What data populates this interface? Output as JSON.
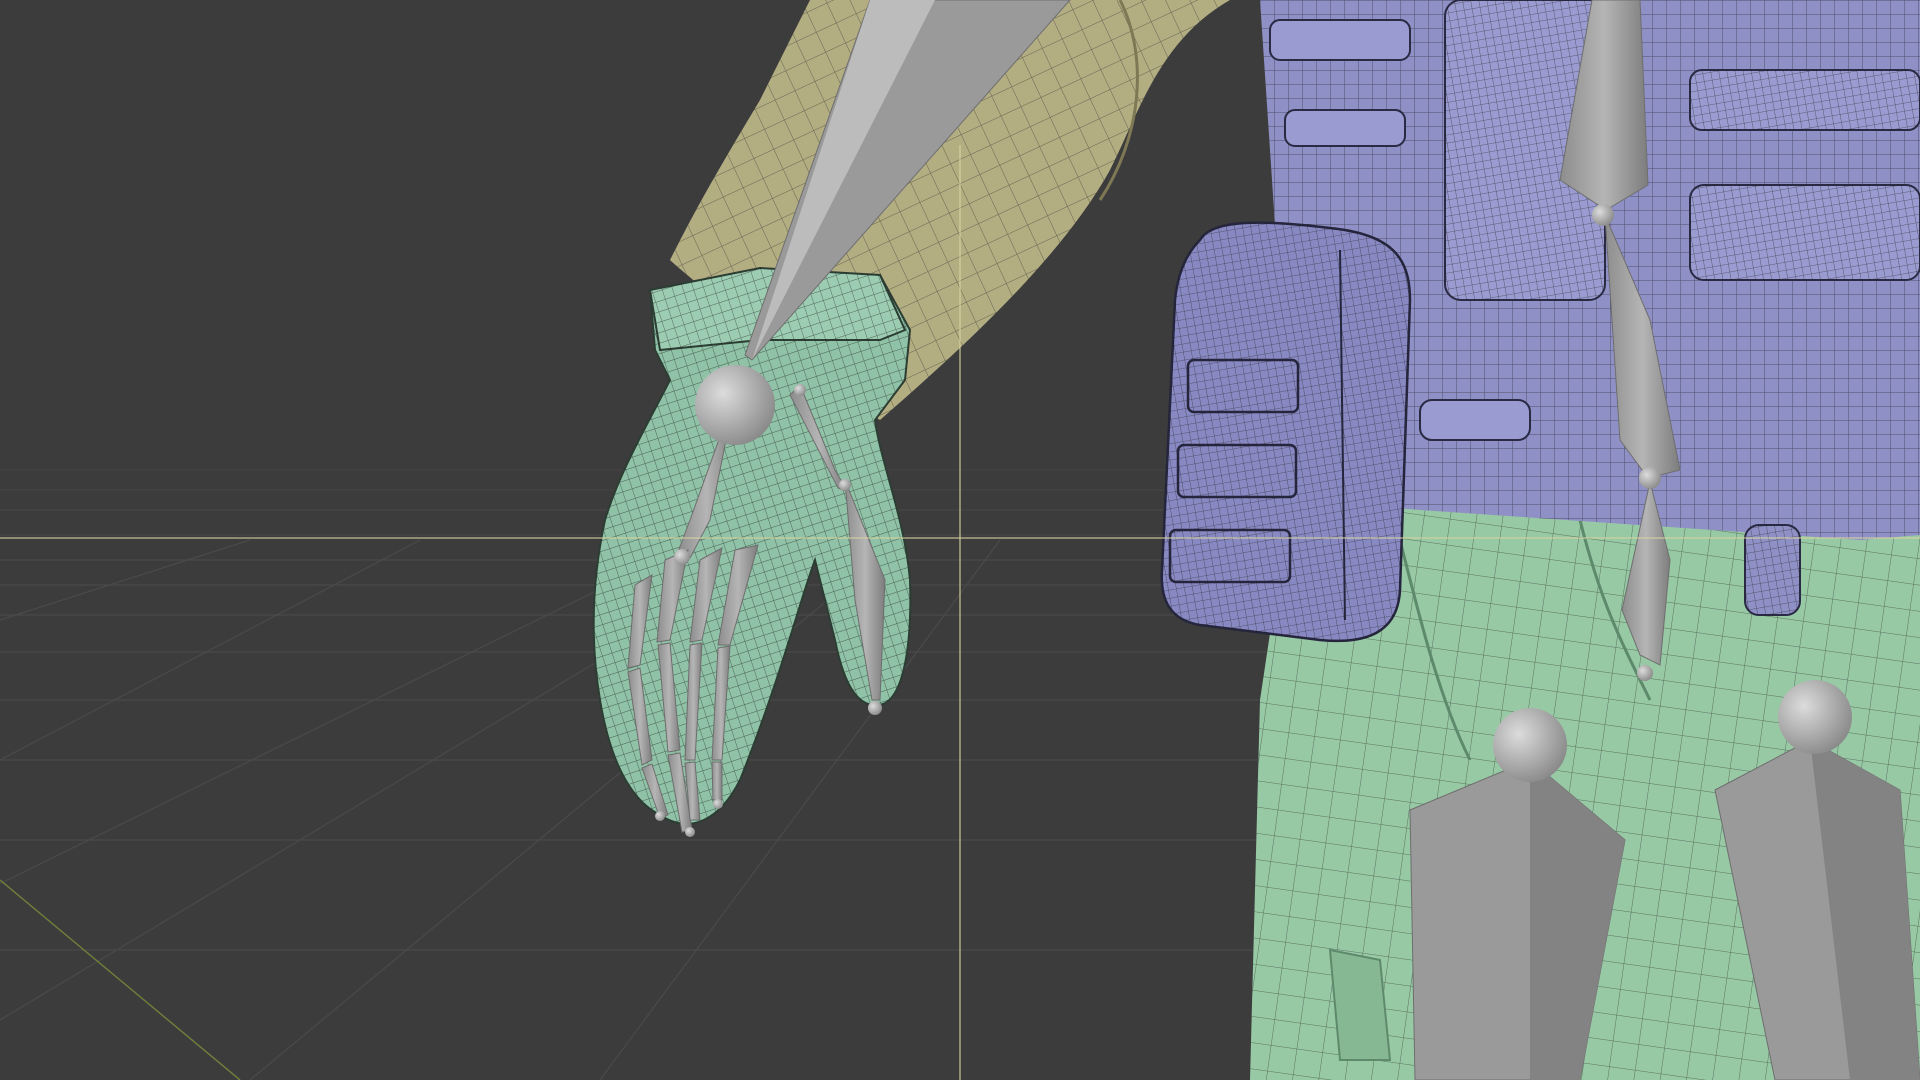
{
  "viewport": {
    "mode": "3d-viewport",
    "background_color": "#3c3c3c",
    "grid_color": "#4a4a4a",
    "cursor_color": "#d8d4a0",
    "x_axis_color": "#6e7d3a"
  },
  "materials": {
    "sleeve": "#b3ad82",
    "glove": "#8fc2a6",
    "vest": "#8f90c6",
    "pants": "#98c9a5",
    "bones": "#a8a8a8",
    "wire": "#1c1c1c"
  },
  "objects": [
    "sleeve",
    "glove",
    "vest",
    "pouch",
    "pants",
    "armature"
  ]
}
